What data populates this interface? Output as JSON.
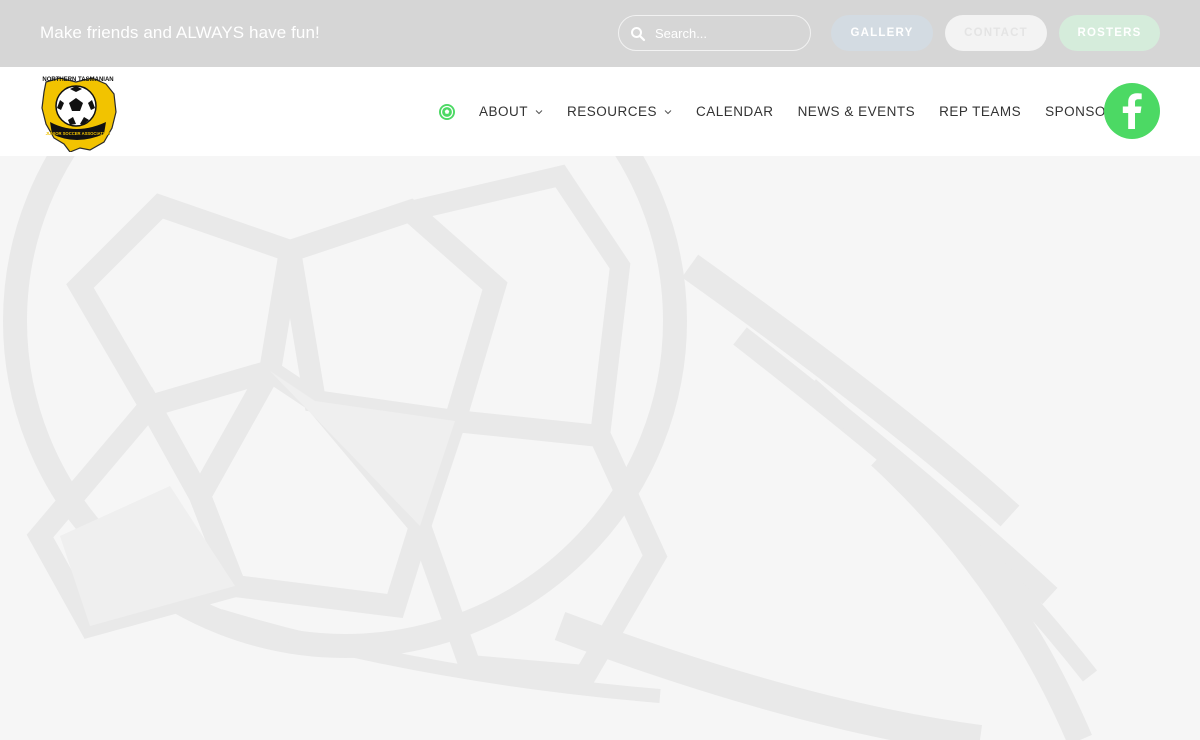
{
  "topbar": {
    "tagline": "Make friends and ALWAYS have fun!",
    "search_placeholder": "Search...",
    "buttons": [
      {
        "label": "GALLERY"
      },
      {
        "label": "CONTACT"
      },
      {
        "label": "ROSTERS"
      }
    ]
  },
  "header": {
    "logo": {
      "top_text": "NORTHERN TASMANIAN",
      "bottom_text": "JUNIOR SOCCER ASSOCIATION"
    },
    "nav": [
      {
        "label": "ABOUT",
        "has_dropdown": true
      },
      {
        "label": "RESOURCES",
        "has_dropdown": true
      },
      {
        "label": "CALENDAR",
        "has_dropdown": false
      },
      {
        "label": "NEWS & EVENTS",
        "has_dropdown": false
      },
      {
        "label": "REP TEAMS",
        "has_dropdown": false
      },
      {
        "label": "SPONSORS",
        "has_dropdown": false
      }
    ]
  },
  "colors": {
    "topbar_bg": "#d6d6d6",
    "accent_green": "#4cd964",
    "gallery_bg": "#d3dbe2",
    "rosters_bg": "#d5ecdb",
    "hero_bg": "#f6f6f6",
    "hero_graphic": "#e9e9e9"
  },
  "icons": {
    "search": "search-icon",
    "home": "soccer-ball-icon",
    "dropdown": "chevron-down-icon",
    "facebook": "facebook-icon"
  }
}
